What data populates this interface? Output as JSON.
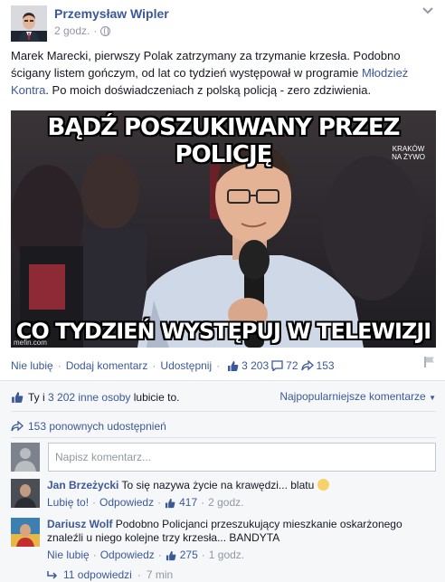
{
  "post": {
    "author": "Przemysław Wipler",
    "time": "2 godz.",
    "text_before_link": "Marek Marecki, pierwszy Polak zatrzymany za trzymanie krzesła. Podobno ścigany listem gończym, od lat co tydzień występował w programie ",
    "link_text": "Młodzież Kontra",
    "text_after_link": ". Po moich doświadczeniach z polską policją - zero zdziwienia.",
    "icons": {
      "privacy": "globe-icon",
      "options": "chevron-down-icon"
    }
  },
  "meme": {
    "top_text": "BĄDŹ POSZUKIWANY PRZEZ POLICJĘ",
    "bottom_text": "CO TYDZIEŃ WYSTĘPUJ W TELEWIZJI",
    "tv_logo_line1": "KRAKÓW",
    "tv_logo_line2": "NA ŻYWO",
    "watermark": "mefin.com"
  },
  "actions": {
    "unlike": "Nie lubię",
    "comment": "Dodaj komentarz",
    "share": "Udostępnij",
    "likes_count": "3 203",
    "comments_count": "72",
    "shares_count": "153"
  },
  "ufi": {
    "likes_prefix": "Ty i ",
    "likes_link": "3 202 inne osoby",
    "likes_suffix": " lubicie to.",
    "sort_label": "Najpopularniejsze komentarze",
    "shares_text": "153 ponownych udostępnień",
    "comment_placeholder": "Napisz komentarz..."
  },
  "comments": [
    {
      "name": "Jan Brzeżycki",
      "text": "To się nazywa życie na krawędzi... blatu",
      "action1": "Lubię to!",
      "action2": "Odpowiedz",
      "likes": "417",
      "time": "2 godz."
    },
    {
      "name": "Dariusz Wolf",
      "text": "Podobno Policjanci przeszukujący mieszkanie oskarżonego znaleźli u niego kolejne trzy krzesła... BANDYTA",
      "action1": "Nie lubię",
      "action2": "Odpowiedz",
      "likes": "275",
      "time": "1 godz."
    }
  ],
  "replies": {
    "label": "11 odpowiedzi",
    "time": "7 min"
  },
  "colors": {
    "link": "#3b5998",
    "text": "#141823",
    "muted": "#9197a3",
    "ufi_bg": "#f6f7f9"
  }
}
